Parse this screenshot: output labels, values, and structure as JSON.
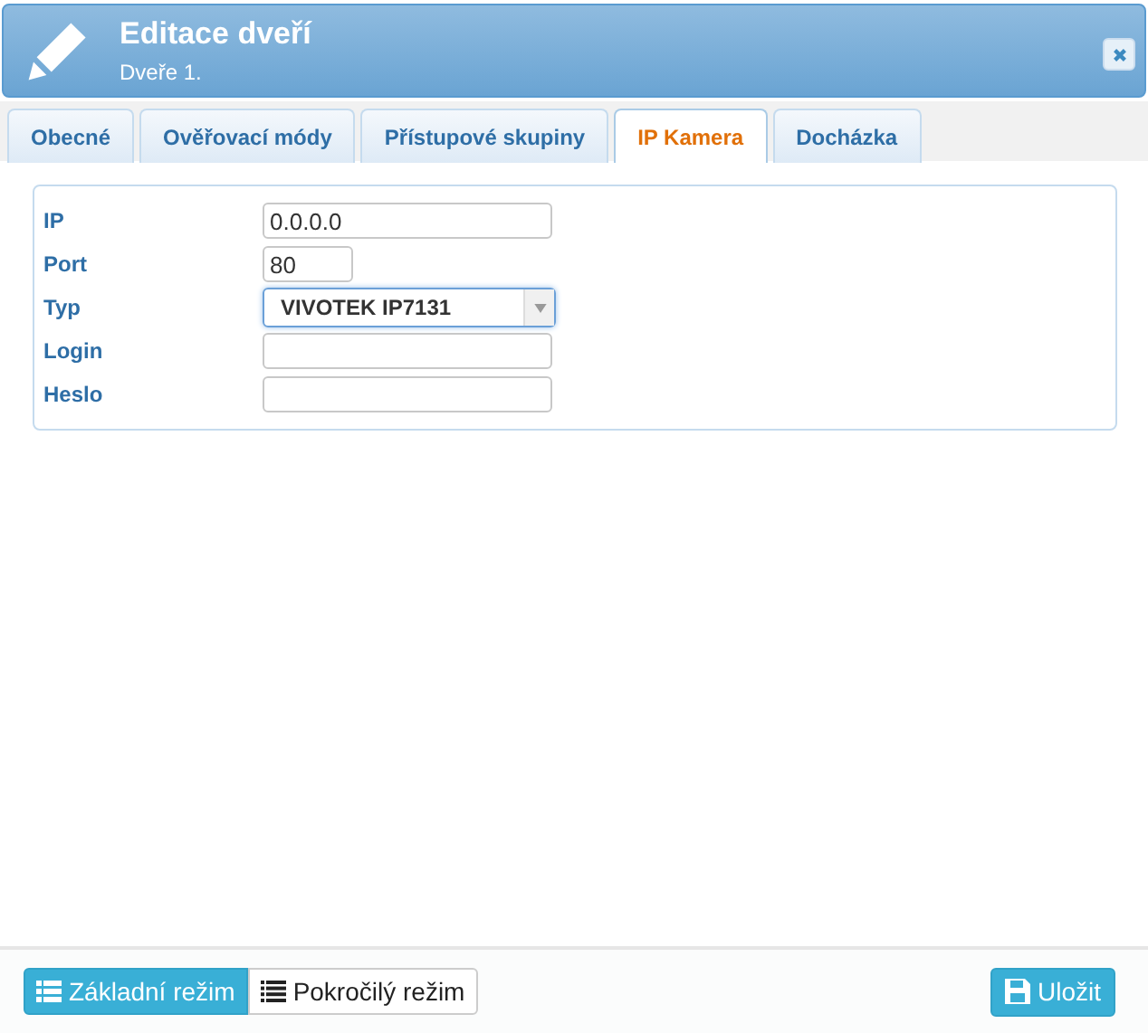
{
  "header": {
    "title": "Editace dveří",
    "subtitle": "Dveře 1."
  },
  "tabs": [
    {
      "label": "Obecné",
      "selected": false
    },
    {
      "label": "Ověřovací módy",
      "selected": false
    },
    {
      "label": "Přístupové skupiny",
      "selected": false
    },
    {
      "label": "IP Kamera",
      "selected": true
    },
    {
      "label": "Docházka",
      "selected": false
    }
  ],
  "fields": [
    {
      "label": "IP",
      "kind": "text",
      "value": "0.0.0.0"
    },
    {
      "label": "Port",
      "kind": "number",
      "value": "80"
    },
    {
      "label": "Typ",
      "kind": "select",
      "value": "VIVOTEK IP7131"
    },
    {
      "label": "Login",
      "kind": "text"
    },
    {
      "label": "Heslo",
      "kind": "password"
    }
  ],
  "modes": [
    {
      "label": "Základní režim",
      "selected": true
    },
    {
      "label": "Pokročilý režim",
      "selected": false
    }
  ],
  "save_button": "Uložit"
}
